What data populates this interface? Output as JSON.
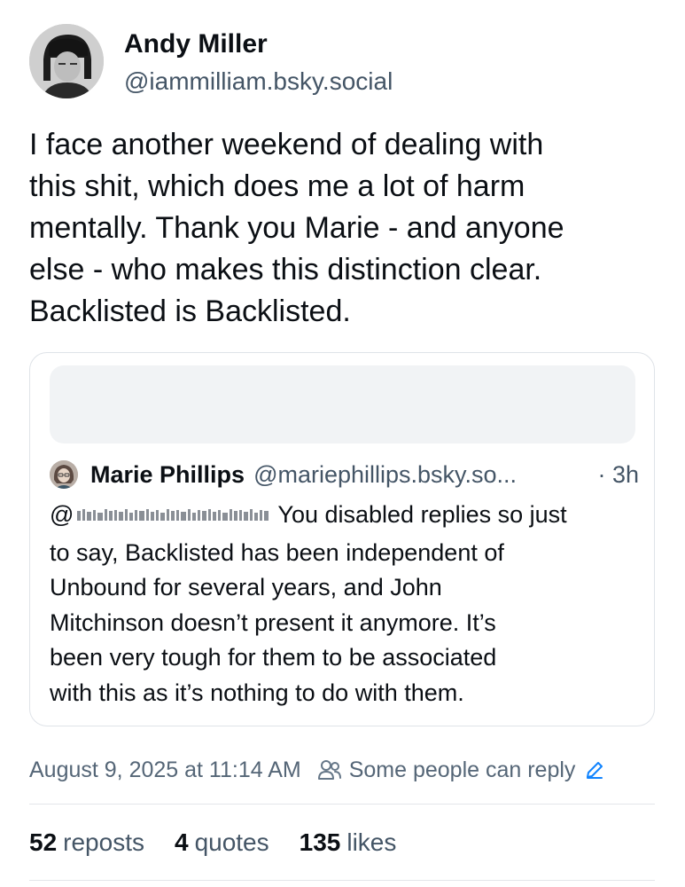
{
  "author": {
    "name": "Andy Miller",
    "handle": "@iammilliam.bsky.social"
  },
  "post": {
    "text_lines": [
      "I face another weekend of dealing with",
      "this shit, which does me a lot of harm",
      "mentally. Thank you Marie - and anyone",
      "else - who makes this distinction clear.",
      "Backlisted is Backlisted."
    ]
  },
  "quote": {
    "author_name": "Marie Phillips",
    "author_handle": "@mariephillips.bsky.so...",
    "time": "· 3h",
    "mention_prefix": "@",
    "text_line1_rest": "You disabled replies so just",
    "text_lines": [
      "to say, Backlisted has been independent of",
      "Unbound for several years, and John",
      "Mitchinson doesn’t present it anymore. It’s",
      "been very tough for them to be associated",
      "with this as it’s nothing to do with them."
    ]
  },
  "meta": {
    "timestamp": "August 9, 2025 at 11:14 AM",
    "reply_setting": "Some people can reply",
    "icons": [
      "people-icon",
      "pencil-icon"
    ],
    "accent_color": "#1083fe"
  },
  "stats": {
    "reposts_count": "52",
    "reposts_label": "reposts",
    "quotes_count": "4",
    "quotes_label": "quotes",
    "likes_count": "135",
    "likes_label": "likes"
  }
}
